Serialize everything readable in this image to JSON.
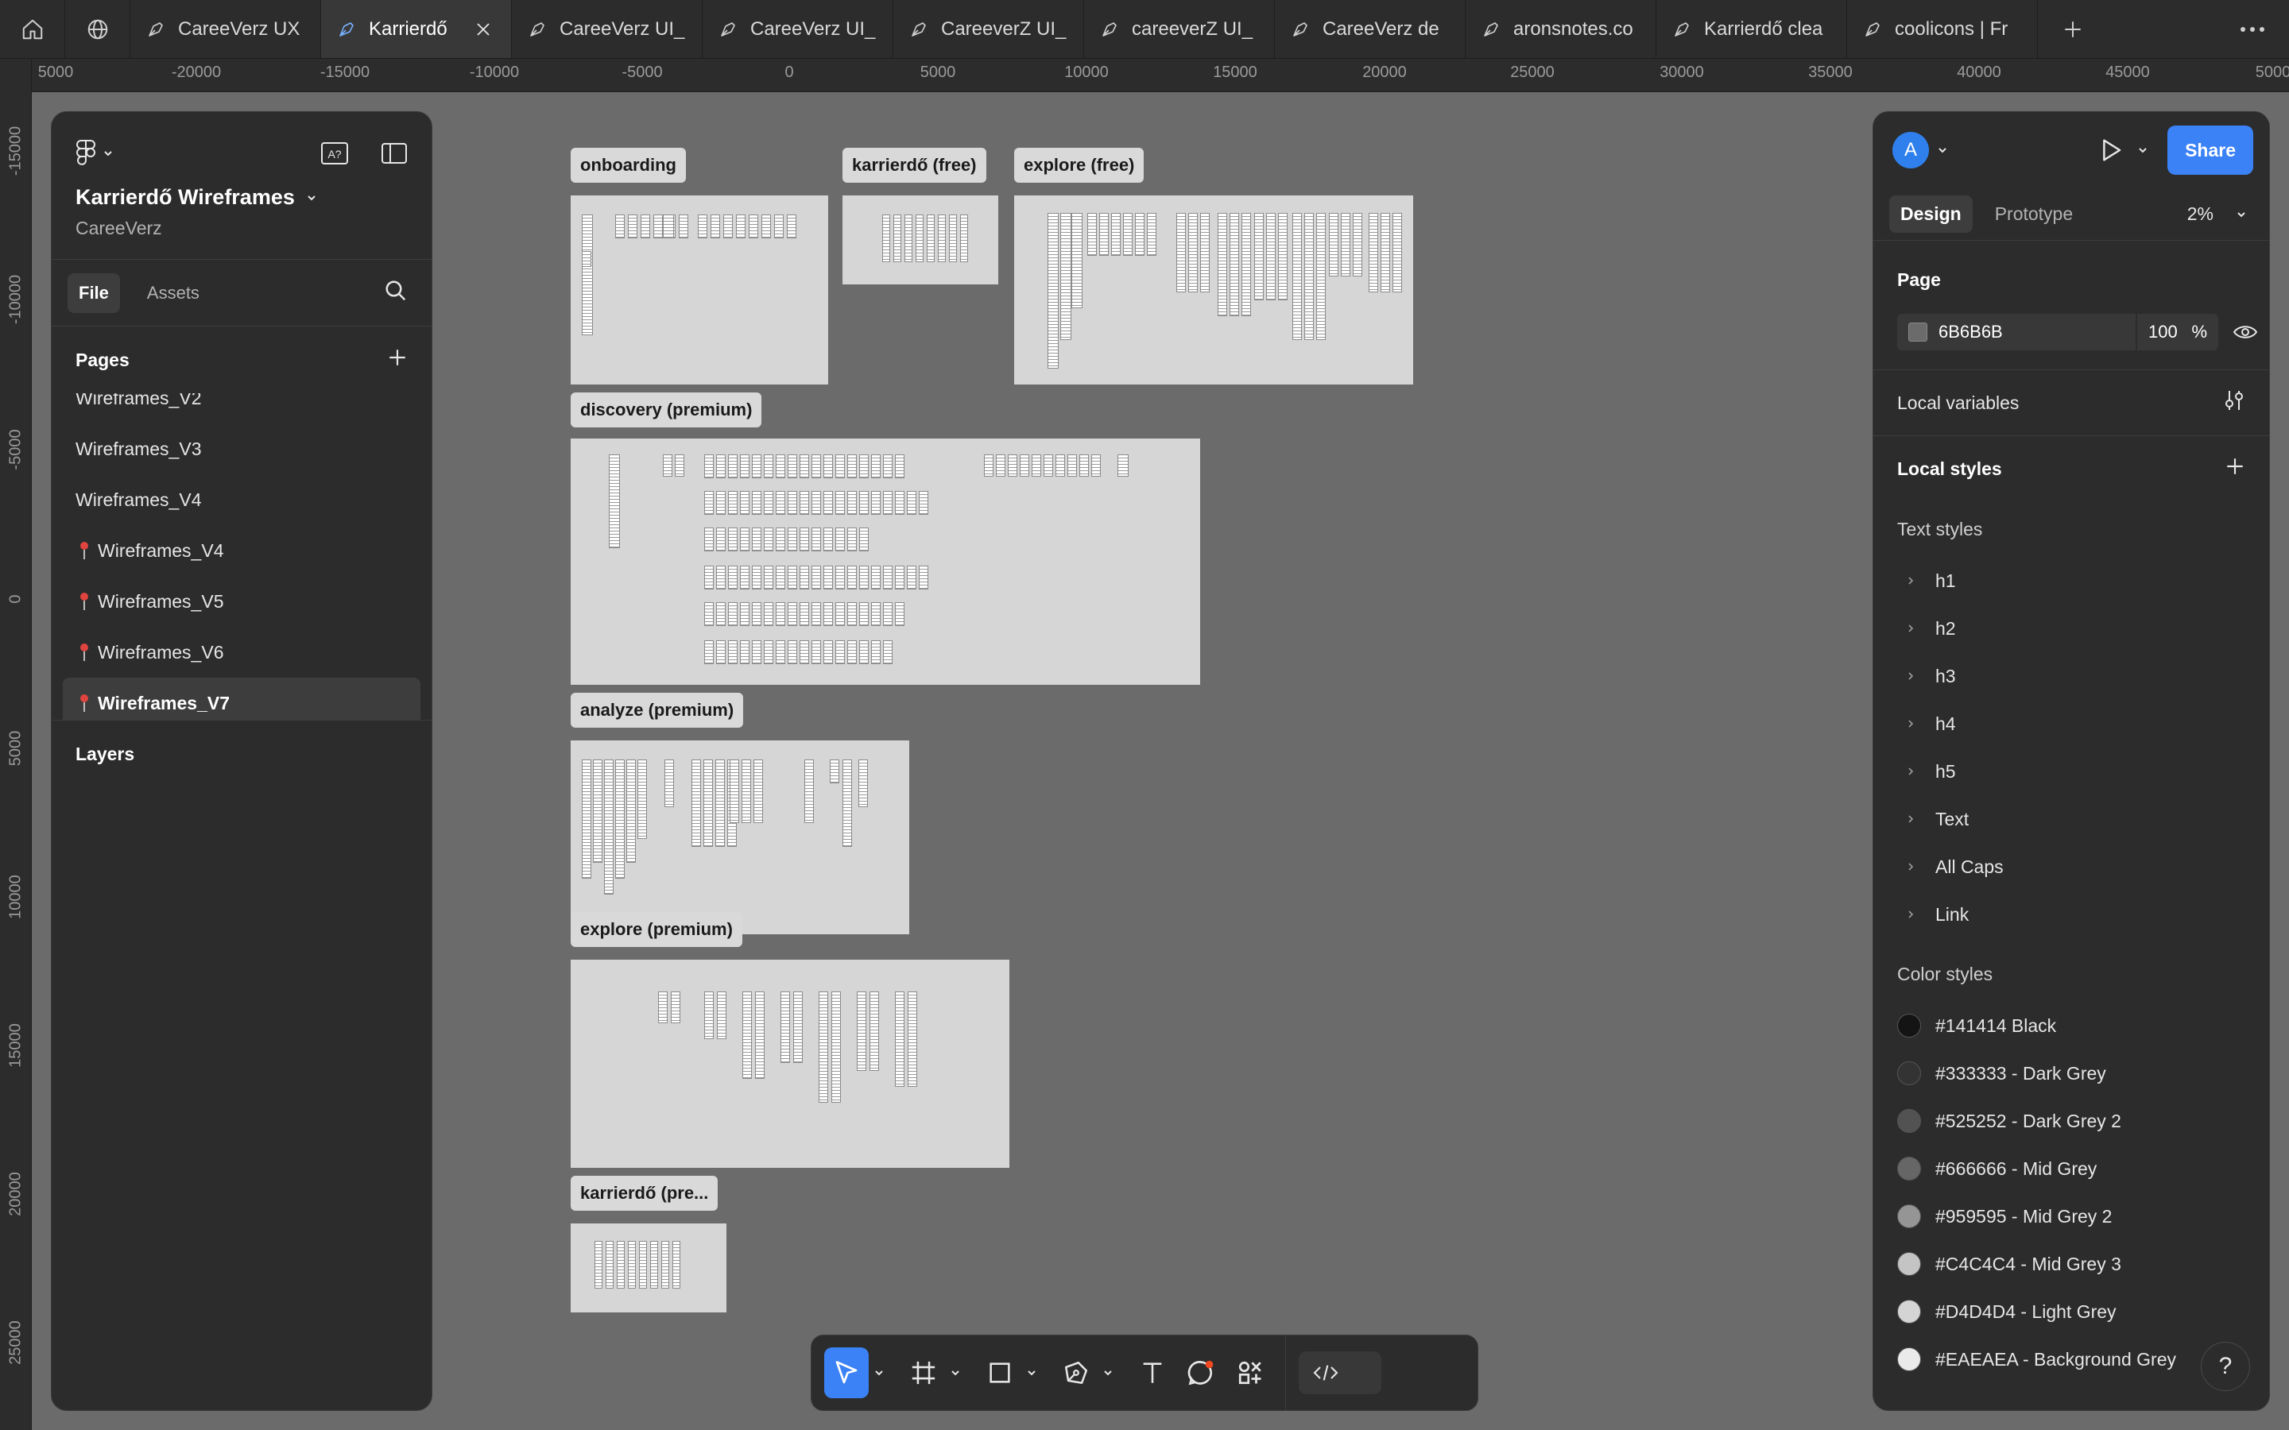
{
  "tabs": [
    {
      "label": "CareeVerz UX",
      "active": false
    },
    {
      "label": "Karrierdő",
      "active": true
    },
    {
      "label": "CareeVerz UI_",
      "active": false
    },
    {
      "label": "CareeVerz UI_",
      "active": false
    },
    {
      "label": "CareeverZ UI_",
      "active": false
    },
    {
      "label": "careeverZ UI_",
      "active": false
    },
    {
      "label": "CareeVerz de",
      "active": false
    },
    {
      "label": "aronsnotes.co",
      "active": false
    },
    {
      "label": "Karrierdő clea",
      "active": false
    },
    {
      "label": "coolicons | Fr",
      "active": false
    }
  ],
  "ruler": {
    "top": [
      "5000",
      "-20000",
      "-15000",
      "-10000",
      "-5000",
      "0",
      "5000",
      "10000",
      "15000",
      "20000",
      "25000",
      "30000",
      "35000",
      "40000",
      "45000",
      "5000"
    ],
    "left": [
      "-15000",
      "-10000",
      "-5000",
      "0",
      "5000",
      "10000",
      "15000",
      "20000",
      "25000"
    ]
  },
  "left_panel": {
    "file_title": "Karrierdő Wireframes",
    "team": "CareeVerz",
    "tabs": {
      "file": "File",
      "assets": "Assets"
    },
    "pages_label": "Pages",
    "pages": [
      {
        "label": "Wireframes_V2",
        "pinned": false,
        "selected": false
      },
      {
        "label": "Wireframes_V3",
        "pinned": false,
        "selected": false
      },
      {
        "label": "Wireframes_V4",
        "pinned": false,
        "selected": false
      },
      {
        "label": "Wireframes_V4",
        "pinned": true,
        "selected": false
      },
      {
        "label": "Wireframes_V5",
        "pinned": true,
        "selected": false
      },
      {
        "label": "Wireframes_V6",
        "pinned": true,
        "selected": false
      },
      {
        "label": "Wireframes_V7",
        "pinned": true,
        "selected": true
      }
    ],
    "layers_label": "Layers"
  },
  "canvas": {
    "frames": [
      {
        "label": "onboarding"
      },
      {
        "label": "karrierdő (free)"
      },
      {
        "label": "explore (free)"
      },
      {
        "label": "discovery (premium)"
      },
      {
        "label": "analyze (premium)"
      },
      {
        "label": "explore (premium)"
      },
      {
        "label": "karrierdő (pre..."
      }
    ]
  },
  "right_panel": {
    "avatar_initial": "A",
    "share_label": "Share",
    "tabs": {
      "design": "Design",
      "prototype": "Prototype"
    },
    "zoom": "2%",
    "page_section": "Page",
    "page_fill_hex": "6B6B6B",
    "page_fill_opacity": "100",
    "percent_sign": "%",
    "local_variables": "Local variables",
    "local_styles": "Local styles",
    "text_styles_label": "Text styles",
    "text_styles": [
      "h1",
      "h2",
      "h3",
      "h4",
      "h5",
      "Text",
      "All Caps",
      "Link"
    ],
    "color_styles_label": "Color styles",
    "color_styles": [
      {
        "label": "#141414 Black",
        "color": "#141414"
      },
      {
        "label": "#333333 - Dark Grey",
        "color": "#333333"
      },
      {
        "label": "#525252 - Dark Grey 2",
        "color": "#525252"
      },
      {
        "label": "#666666 - Mid Grey",
        "color": "#666666"
      },
      {
        "label": "#959595 - Mid Grey 2",
        "color": "#959595"
      },
      {
        "label": "#C4C4C4 - Mid Grey 3",
        "color": "#C4C4C4"
      },
      {
        "label": "#D4D4D4 - Light Grey",
        "color": "#D4D4D4"
      },
      {
        "label": "#EAEAEA - Background Grey",
        "color": "#EAEAEA"
      }
    ],
    "help_label": "?"
  },
  "colors": {
    "canvas_bg": "#6B6B6B",
    "panel_bg": "#2C2C2C",
    "accent": "#3B82F6",
    "frame_bg": "#D6D6D6"
  },
  "toolbar": {
    "tools": [
      "move-tool",
      "frame-tool",
      "rectangle-tool",
      "pen-tool",
      "text-tool",
      "comment-tool",
      "actions-tool",
      "dev-mode-toggle"
    ]
  }
}
